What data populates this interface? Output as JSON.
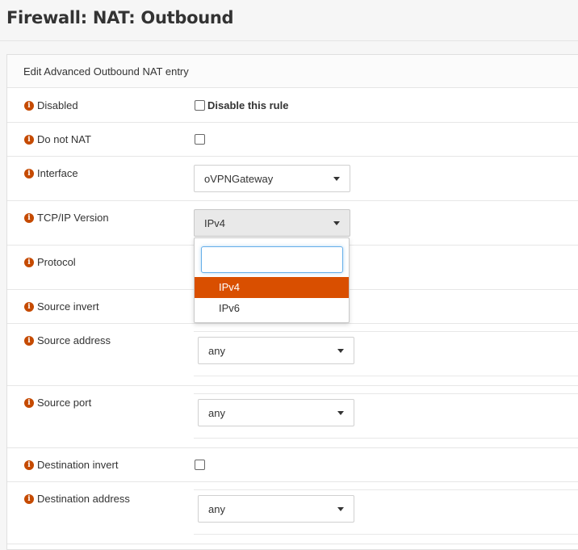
{
  "page": {
    "title": "Firewall: NAT: Outbound"
  },
  "panel": {
    "header": "Edit Advanced Outbound NAT entry"
  },
  "rows": {
    "disabled": {
      "label": "Disabled",
      "checkbox_label": "Disable this rule"
    },
    "do_not_nat": {
      "label": "Do not NAT"
    },
    "interface": {
      "label": "Interface",
      "value": "oVPNGateway"
    },
    "tcpip_version": {
      "label": "TCP/IP Version",
      "value": "IPv4"
    },
    "protocol": {
      "label": "Protocol"
    },
    "source_invert": {
      "label": "Source invert"
    },
    "source_address": {
      "label": "Source address",
      "value": "any"
    },
    "source_port": {
      "label": "Source port",
      "value": "any"
    },
    "destination_invert": {
      "label": "Destination invert"
    },
    "destination_address": {
      "label": "Destination address",
      "value": "any"
    }
  },
  "dropdown": {
    "search_value": "",
    "options": [
      "IPv4",
      "IPv6"
    ],
    "highlighted": "IPv4"
  },
  "colors": {
    "accent": "#d94f00",
    "info_icon": "#c54a00"
  },
  "icons": {
    "info": "info-icon",
    "caret": "chevron-down-icon"
  }
}
